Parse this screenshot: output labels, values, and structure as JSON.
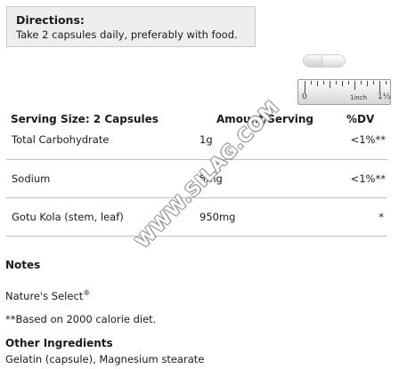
{
  "directions": {
    "title": "Directions:",
    "text": "Take 2 capsules daily, preferably with food."
  },
  "ruler": {
    "label_zero": "0",
    "label_inch": "1inch",
    "label_half": "1½"
  },
  "supplement_facts": {
    "header": {
      "serving_size": "Serving Size: 2 Capsules",
      "amount": "Amount/Serving",
      "dv": "%DV"
    },
    "rows": [
      {
        "name": "Total Carbohydrate",
        "amount": "1g",
        "dv": "<1%**"
      },
      {
        "name": "Sodium",
        "amount": "5mg",
        "dv": "<1%**"
      },
      {
        "name": "Gotu Kola (stem, leaf)",
        "amount": "950mg",
        "dv": "*"
      }
    ]
  },
  "notes": {
    "title": "Notes",
    "brand": "Nature's Select",
    "brand_mark": "®",
    "footnote": "**Based on 2000 calorie diet."
  },
  "other_ingredients": {
    "title": "Other Ingredients",
    "text": "Gelatin (capsule), Magnesium stearate"
  },
  "watermark": "WWW.SILAG.COM"
}
